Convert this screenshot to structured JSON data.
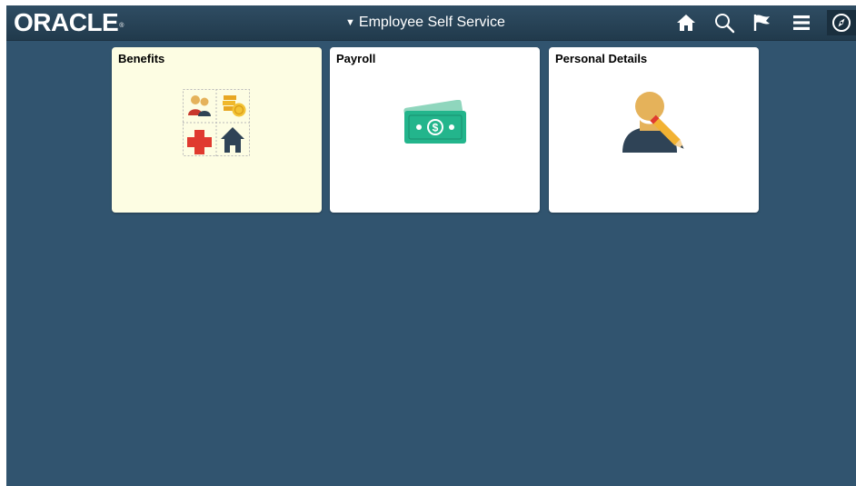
{
  "brand": {
    "logo_text": "ORACLE",
    "logo_mark": "®"
  },
  "header": {
    "title": "Employee Self Service",
    "caret_icon": "triangle-down",
    "buttons": [
      {
        "name": "home-button",
        "icon": "home-icon"
      },
      {
        "name": "search-button",
        "icon": "search-icon"
      },
      {
        "name": "notifications-button",
        "icon": "flag-icon"
      },
      {
        "name": "actions-menu-button",
        "icon": "hamburger-icon"
      },
      {
        "name": "navbar-button",
        "icon": "compass-icon"
      }
    ]
  },
  "tiles": [
    {
      "label": "Benefits",
      "icon": "benefits-grid-icon"
    },
    {
      "label": "Payroll",
      "icon": "money-icon"
    },
    {
      "label": "Personal Details",
      "icon": "person-edit-icon"
    }
  ],
  "colors": {
    "background": "#31546f",
    "header": "#213a4c",
    "benefits_tile": "#fdfde3",
    "money_green": "#23b58c",
    "person_orange": "#e5b25a",
    "person_dark": "#2f4356",
    "red_cross": "#e03a2f"
  }
}
